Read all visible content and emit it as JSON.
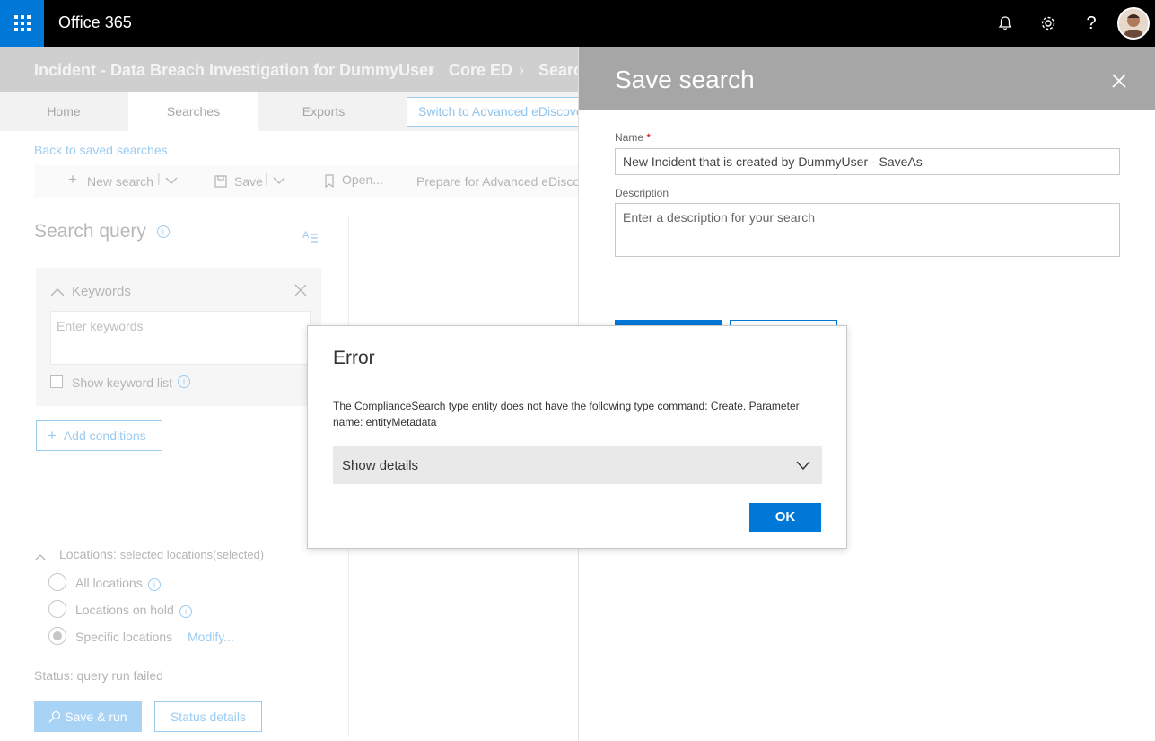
{
  "topbar": {
    "app_title": "Office 365",
    "colors": {
      "bar": "#000000",
      "waffle": "#0078d7"
    }
  },
  "breadcrumb": {
    "items": [
      "Incident - Data Breach Investigation for DummyUser",
      "Core ED",
      "Searc"
    ]
  },
  "tabs": [
    {
      "label": "Home"
    },
    {
      "label": "Searches"
    },
    {
      "label": "Exports"
    }
  ],
  "advanced_button_label": "Switch to Advanced eDiscove",
  "back_link": "Back to saved searches",
  "command_bar": {
    "new_search": "New search",
    "save": "Save",
    "open": "Open...",
    "prepare": "Prepare for Advanced eDisco"
  },
  "search_query": {
    "title": "Search query",
    "keywords_label": "Keywords",
    "keywords_placeholder": "Enter keywords",
    "show_keyword_list": "Show keyword list",
    "add_conditions": "Add conditions"
  },
  "locations": {
    "title_prefix": "Locations:",
    "title_suffix": "selected locations(selected)",
    "options": [
      "All locations",
      "Locations on hold",
      "Specific locations"
    ],
    "selected": "Specific locations",
    "modify_link": "Modify..."
  },
  "status_text": "Status: query run failed",
  "bottom_buttons": {
    "save_run": "Save & run",
    "status_details": "Status details"
  },
  "save_panel": {
    "title": "Save search",
    "name_label": "Name",
    "required_mark": "*",
    "name_value": "New Incident that is created by DummyUser - SaveAs",
    "description_label": "Description",
    "description_placeholder": "Enter a description for your search"
  },
  "error_dialog": {
    "title": "Error",
    "message": "The ComplianceSearch type entity does not have the following type command: Create. Parameter name: entityMetadata",
    "details_label": "Show details",
    "ok_label": "OK",
    "accent": "#0078d7"
  }
}
